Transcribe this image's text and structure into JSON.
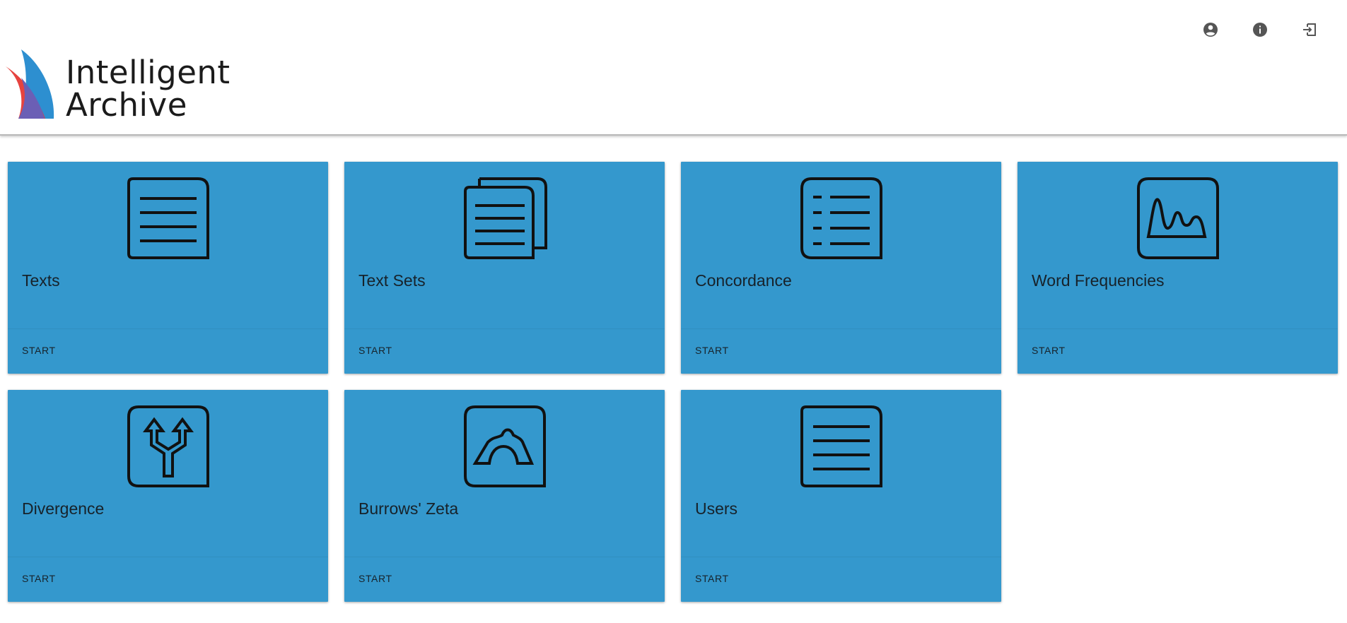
{
  "app": {
    "logo_line1": "Intelligent",
    "logo_line2": "Archive"
  },
  "header": {
    "actions": [
      {
        "icon": "account-circle-icon"
      },
      {
        "icon": "info-icon"
      },
      {
        "icon": "logout-icon"
      }
    ]
  },
  "cards": [
    {
      "title": "Texts",
      "action": "START",
      "icon": "document-icon"
    },
    {
      "title": "Text Sets",
      "action": "START",
      "icon": "documents-stack-icon"
    },
    {
      "title": "Concordance",
      "action": "START",
      "icon": "bulleted-list-icon"
    },
    {
      "title": "Word Frequencies",
      "action": "START",
      "icon": "frequency-curve-icon"
    },
    {
      "title": "Divergence",
      "action": "START",
      "icon": "diverging-arrows-icon"
    },
    {
      "title": "Burrows' Zeta",
      "action": "START",
      "icon": "bridge-shape-icon"
    },
    {
      "title": "Users",
      "action": "START",
      "icon": "document-icon"
    }
  ],
  "colors": {
    "card_background": "#3498cd",
    "logo_red": "#e53935",
    "logo_blue": "#2d8fd0",
    "logo_purple": "#6b5fb5"
  }
}
